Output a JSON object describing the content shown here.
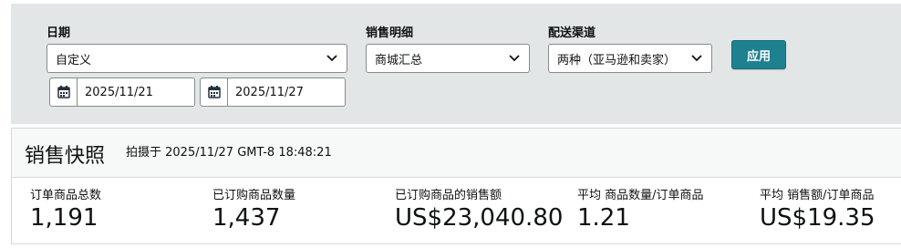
{
  "filters": {
    "date": {
      "label": "日期",
      "value": "自定义"
    },
    "sales_detail": {
      "label": "销售明细",
      "value": "商城汇总"
    },
    "channel": {
      "label": "配送渠道",
      "value": "两种（亚马逊和卖家）"
    },
    "start_date": "2025/11/21",
    "end_date": "2025/11/27",
    "apply_label": "应用"
  },
  "snapshot": {
    "title": "销售快照",
    "timestamp": "拍摄于 2025/11/27 GMT-8 18:48:21",
    "metrics": [
      {
        "label": "订单商品总数",
        "value": "1,191"
      },
      {
        "label": "已订购商品数量",
        "value": "1,437"
      },
      {
        "label": "已订购商品的销售额",
        "value": "US$23,040.80"
      },
      {
        "label": "平均 商品数量/订单商品",
        "value": "1.21"
      },
      {
        "label": "平均 销售额/订单商品",
        "value": "US$19.35"
      }
    ]
  },
  "colors": {
    "accent": "#1d8190",
    "panel": "#e3e6e6"
  },
  "icons": {
    "calendar": "calendar-icon",
    "dropdown": "chevron-down-icon"
  }
}
